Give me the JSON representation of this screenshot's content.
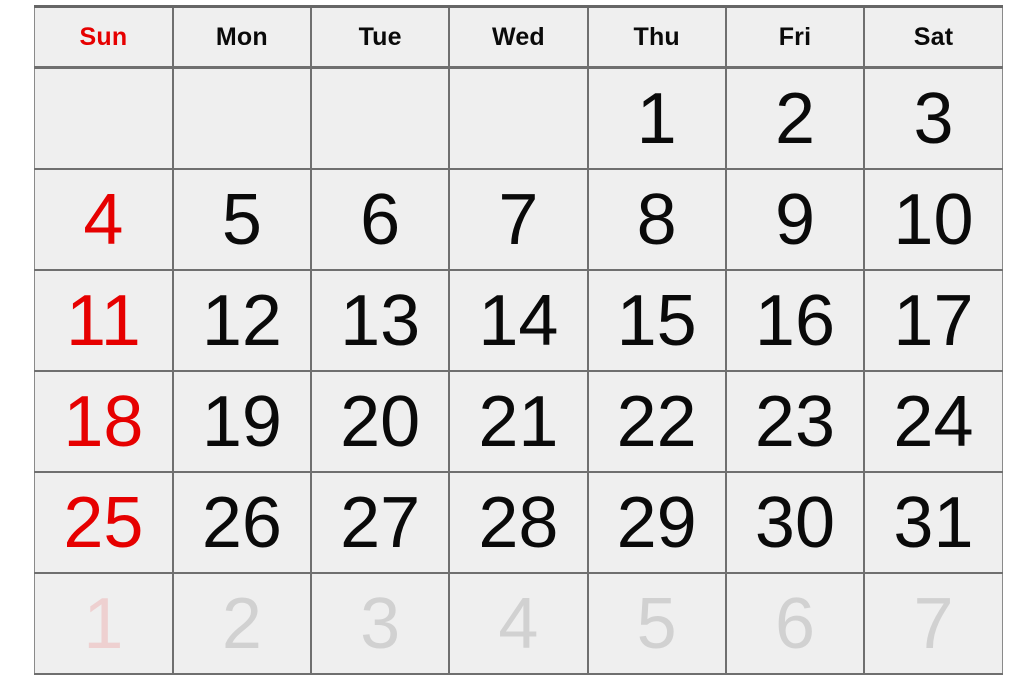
{
  "calendar": {
    "weekday_headers": [
      {
        "label": "Sun",
        "is_sunday": true
      },
      {
        "label": "Mon",
        "is_sunday": false
      },
      {
        "label": "Tue",
        "is_sunday": false
      },
      {
        "label": "Wed",
        "is_sunday": false
      },
      {
        "label": "Thu",
        "is_sunday": false
      },
      {
        "label": "Fri",
        "is_sunday": false
      },
      {
        "label": "Sat",
        "is_sunday": false
      }
    ],
    "weeks": [
      {
        "days": [
          "",
          "",
          "",
          "",
          "1",
          "2",
          "3"
        ]
      },
      {
        "days": [
          "4",
          "5",
          "6",
          "7",
          "8",
          "9",
          "10"
        ]
      },
      {
        "days": [
          "11",
          "12",
          "13",
          "14",
          "15",
          "16",
          "17"
        ]
      },
      {
        "days": [
          "18",
          "19",
          "20",
          "21",
          "22",
          "23",
          "24"
        ]
      },
      {
        "days": [
          "25",
          "26",
          "27",
          "28",
          "29",
          "30",
          "31"
        ]
      }
    ],
    "overflow_week": {
      "days": [
        "1",
        "2",
        "3",
        "4",
        "5",
        "6",
        "7"
      ]
    },
    "colors": {
      "sunday_text": "#e60000",
      "weekday_text": "#0a0a0a",
      "cell_background": "#efefef",
      "grid_line": "#6f6f6f",
      "page_background": "#ffffff"
    }
  }
}
